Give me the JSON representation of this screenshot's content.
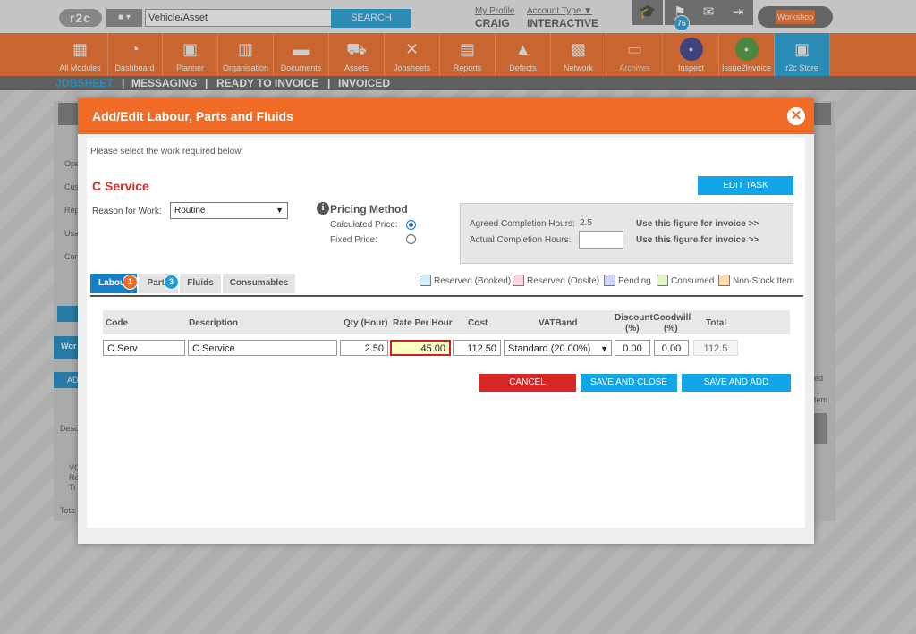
{
  "topbar": {
    "logo": "r2c",
    "vehicle_dropdown": "▾",
    "search_value": "Vehicle/Asset",
    "search_button": "SEARCH",
    "my_profile_label": "My Profile",
    "user_name": "CRAIG",
    "account_type_label": "Account Type",
    "account_type_value": "INTERACTIVE",
    "notification_count": "76",
    "workshop_label": "Workshop"
  },
  "nav": {
    "items": [
      {
        "label": "All Modules",
        "icon": "grid-icon"
      },
      {
        "label": "Dashboard",
        "icon": "gauge-icon"
      },
      {
        "label": "Planner",
        "icon": "calendar-icon"
      },
      {
        "label": "Organisation",
        "icon": "building-icon"
      },
      {
        "label": "Documents",
        "icon": "folder-icon"
      },
      {
        "label": "Assets",
        "icon": "truck-icon"
      },
      {
        "label": "Jobsheets",
        "icon": "tools-icon"
      },
      {
        "label": "Reports",
        "icon": "clipboard-icon"
      },
      {
        "label": "Defects",
        "icon": "warning-icon"
      },
      {
        "label": "Network",
        "icon": "network-icon"
      },
      {
        "label": "Archives",
        "icon": "archive-icon"
      },
      {
        "label": "Inspect",
        "icon": "inspect-icon"
      },
      {
        "label": "Issue2Invoice",
        "icon": "i2i-icon"
      },
      {
        "label": "r2c Store",
        "icon": "briefcase-icon"
      }
    ]
  },
  "subnav": {
    "jobsheet": "JOBSHEET",
    "messaging": "MESSAGING",
    "ready_to_invoice": "READY TO INVOICE",
    "invoiced": "INVOICED",
    "sep": "|"
  },
  "background": {
    "labels": [
      "Ope",
      "Cus",
      "Rep",
      "Usa",
      "Con",
      "Wor",
      "AD",
      "Desc",
      "VO",
      "Re",
      "Tr",
      "Tota",
      "ed",
      "tem"
    ]
  },
  "modal": {
    "title": "Add/Edit Labour, Parts and Fluids",
    "close_glyph": "✕",
    "instruction": "Please select the work required below:",
    "service_title": "C Service",
    "edit_task": "EDIT TASK",
    "reason_label": "Reason for Work:",
    "reason_value": "Routine",
    "pricing": {
      "title": "Pricing Method",
      "info_glyph": "i",
      "calculated_label": "Calculated Price:",
      "fixed_label": "Fixed Price:",
      "selected": "calculated"
    },
    "hours": {
      "agreed_label": "Agreed Completion Hours:",
      "agreed_value": "2.5",
      "actual_label": "Actual Completion Hours:",
      "actual_value": "",
      "link1": "Use this figure for invoice >>",
      "link2": "Use this figure for invoice >>"
    },
    "tabs": [
      {
        "label": "Labour",
        "badge": "1",
        "badge_color": "#f06c26"
      },
      {
        "label": "Parts",
        "badge": "3",
        "badge_color": "#1e9fd6"
      },
      {
        "label": "Fluids"
      },
      {
        "label": "Consumables"
      }
    ],
    "legend": [
      {
        "label": "Reserved (Booked)",
        "color": "#d5eefb"
      },
      {
        "label": "Reserved (Onsite)",
        "color": "#fbd5e6"
      },
      {
        "label": "Pending",
        "color": "#d0d4f5"
      },
      {
        "label": "Consumed",
        "color": "#dff5c8"
      },
      {
        "label": "Non-Stock Item",
        "color": "#fbdcb0"
      }
    ],
    "table": {
      "headers": {
        "code": "Code",
        "description": "Description",
        "qty": "Qty (Hour)",
        "rate": "Rate Per Hour",
        "cost": "Cost",
        "vatband": "VATBand",
        "discount": "Discount",
        "discount_unit": "(%)",
        "goodwill": "Goodwill",
        "goodwill_unit": "(%)",
        "total": "Total"
      },
      "row": {
        "code": "C Serv",
        "description": "C Service",
        "qty": "2.50",
        "rate": "45.00",
        "cost": "112.50",
        "vatband": "Standard (20.00%)",
        "discount": "0.00",
        "goodwill": "0.00",
        "total": "112.5"
      }
    },
    "buttons": {
      "cancel": "CANCEL",
      "save_close": "SAVE AND CLOSE",
      "save_add": "SAVE AND ADD ANOTHER"
    }
  }
}
